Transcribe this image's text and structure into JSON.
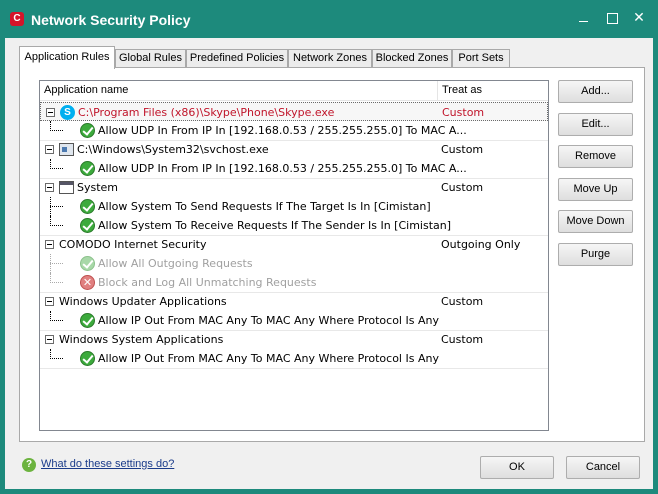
{
  "window": {
    "title": "Network Security Policy",
    "logo_glyph": "C",
    "close_glyph": "✕"
  },
  "tabs": [
    {
      "label": "Application Rules",
      "active": true
    },
    {
      "label": "Global Rules"
    },
    {
      "label": "Predefined Policies"
    },
    {
      "label": "Network Zones"
    },
    {
      "label": "Blocked Zones"
    },
    {
      "label": "Port Sets"
    }
  ],
  "list": {
    "columns": [
      "Application name",
      "Treat as"
    ],
    "rows": [
      {
        "name": "C:\\Program Files (x86)\\Skype\\Phone\\Skype.exe",
        "treat": "Custom",
        "type": "app",
        "icon": "skype-icon",
        "selected": true
      },
      {
        "name": "Allow UDP In From IP In [192.168.0.53 / 255.255.255.0] To MAC A...",
        "type": "rule",
        "icon": "check-icon"
      },
      {
        "name": "C:\\Windows\\System32\\svchost.exe",
        "treat": "Custom",
        "type": "app",
        "icon": "service-icon"
      },
      {
        "name": "Allow UDP In From IP In [192.168.0.53 / 255.255.255.0] To MAC A...",
        "type": "rule",
        "icon": "check-icon"
      },
      {
        "name": "System",
        "treat": "Custom",
        "type": "app",
        "icon": "window-icon"
      },
      {
        "name": "Allow System To Send Requests If The Target Is In [Cimistan]",
        "type": "rule",
        "icon": "check-icon"
      },
      {
        "name": "Allow System To Receive Requests If The Sender Is  In [Cimistan]",
        "type": "rule",
        "icon": "check-icon"
      },
      {
        "name": "COMODO Internet Security",
        "treat": "Outgoing Only",
        "type": "app",
        "icon": "none"
      },
      {
        "name": "Allow All Outgoing Requests",
        "type": "rule",
        "icon": "check-icon",
        "disabled": true
      },
      {
        "name": "Block and Log All Unmatching Requests",
        "type": "rule",
        "icon": "block-icon",
        "disabled": true
      },
      {
        "name": "Windows Updater Applications",
        "treat": "Custom",
        "type": "app",
        "icon": "none"
      },
      {
        "name": "Allow IP Out From MAC Any To MAC Any Where Protocol Is Any",
        "type": "rule",
        "icon": "check-icon"
      },
      {
        "name": "Windows System Applications",
        "treat": "Custom",
        "type": "app",
        "icon": "none"
      },
      {
        "name": "Allow IP Out From MAC Any To MAC Any Where Protocol Is Any",
        "type": "rule",
        "icon": "check-icon"
      }
    ]
  },
  "side_buttons": [
    "Add...",
    "Edit...",
    "Remove",
    "Move Up",
    "Move Down",
    "Purge"
  ],
  "footer": {
    "help_glyph": "?",
    "help_link": "What do these settings do?",
    "ok_label": "OK",
    "cancel_label": "Cancel"
  },
  "colors": {
    "title_bar": "#1d8a7c",
    "selected_text": "#c0142a",
    "disabled_text": "#a0a0a0"
  }
}
